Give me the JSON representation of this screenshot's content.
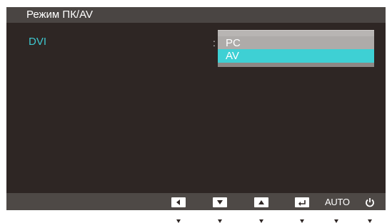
{
  "osd": {
    "title": "Режим ПК/AV",
    "menu_item": "DVI",
    "separator": ":",
    "options": [
      {
        "label": "PC",
        "selected": false
      },
      {
        "label": "AV",
        "selected": true
      }
    ]
  },
  "controls": {
    "left_icon": "left-arrow-icon",
    "down_icon": "down-arrow-icon",
    "up_icon": "up-arrow-icon",
    "enter_icon": "enter-icon",
    "auto_label": "AUTO",
    "power_icon": "power-icon"
  },
  "colors": {
    "panel": "#2e2624",
    "title_bar": "#4a4543",
    "accent": "#3ec7cf",
    "selected_option": "#3ed0d4",
    "option_bg": "#aeaba9"
  }
}
